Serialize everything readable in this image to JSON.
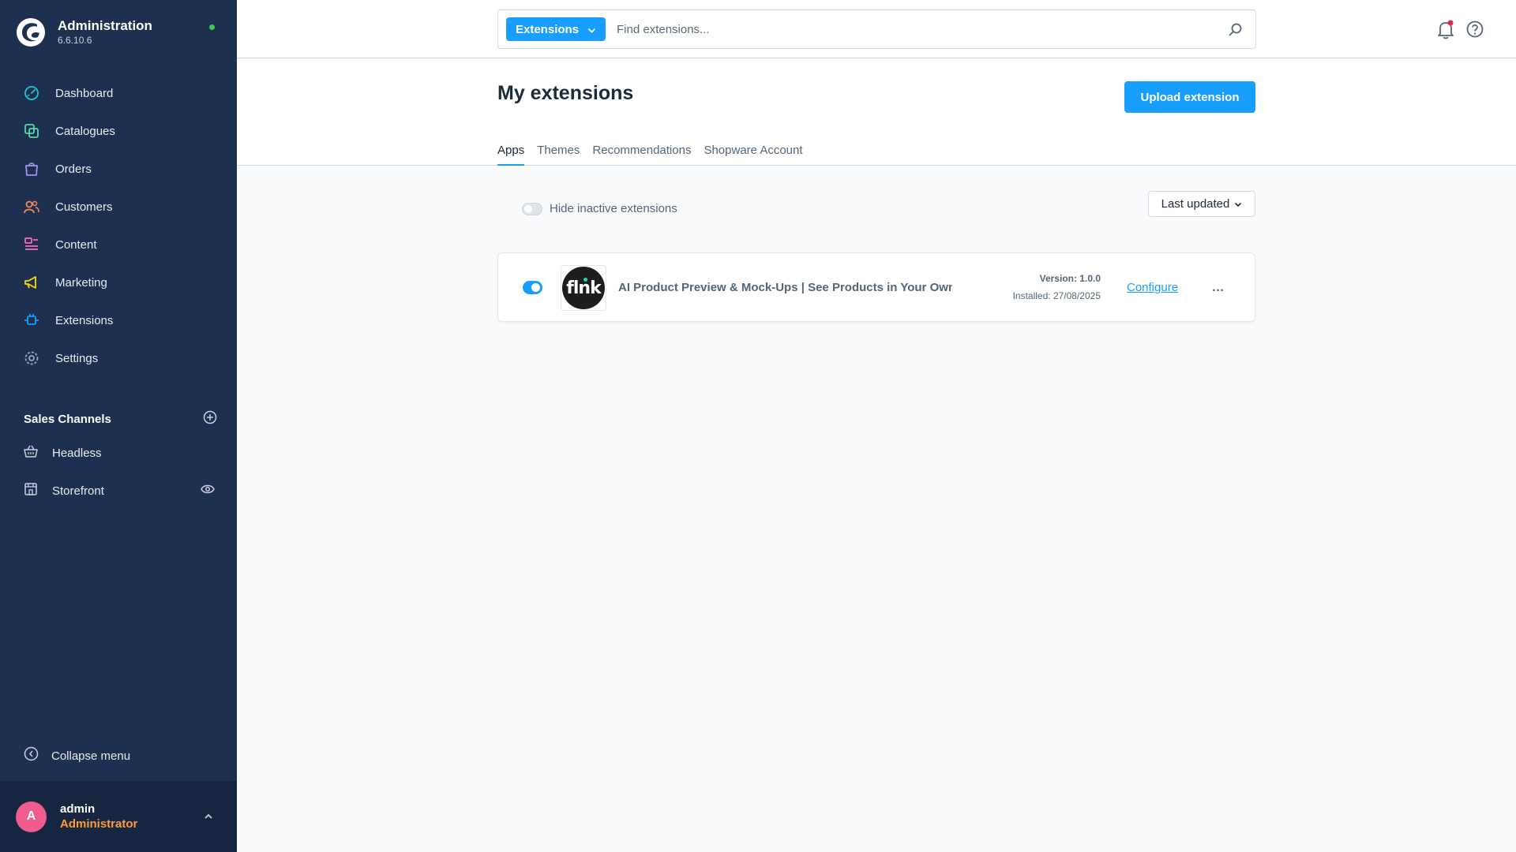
{
  "app": {
    "title": "Administration",
    "version": "6.6.10.6",
    "status_color": "#37d046"
  },
  "sidebar": {
    "items": [
      {
        "label": "Dashboard",
        "icon": "dashboard-icon",
        "color": "#28c2d9"
      },
      {
        "label": "Catalogues",
        "icon": "catalogues-icon",
        "color": "#57d9a3"
      },
      {
        "label": "Orders",
        "icon": "orders-icon",
        "color": "#a092f0"
      },
      {
        "label": "Customers",
        "icon": "customers-icon",
        "color": "#f88962"
      },
      {
        "label": "Content",
        "icon": "content-icon",
        "color": "#ff68b4"
      },
      {
        "label": "Marketing",
        "icon": "marketing-icon",
        "color": "#ffd700"
      },
      {
        "label": "Extensions",
        "icon": "extensions-icon",
        "color": "#189eff"
      },
      {
        "label": "Settings",
        "icon": "settings-icon",
        "color": "#9aa8b5"
      }
    ],
    "sales_channels": {
      "title": "Sales Channels",
      "items": [
        {
          "label": "Headless",
          "icon": "basket-icon"
        },
        {
          "label": "Storefront",
          "icon": "storefront-icon"
        }
      ]
    },
    "collapse_label": "Collapse menu",
    "user": {
      "initial": "A",
      "name": "admin",
      "role": "Administrator"
    }
  },
  "topbar": {
    "search_type": "Extensions",
    "search_placeholder": "Find extensions..."
  },
  "page": {
    "title": "My extensions",
    "upload_label": "Upload extension",
    "tabs": [
      {
        "label": "Apps",
        "active": true
      },
      {
        "label": "Themes",
        "active": false
      },
      {
        "label": "Recommendations",
        "active": false
      },
      {
        "label": "Shopware Account",
        "active": false
      }
    ],
    "hide_inactive_label": "Hide inactive extensions",
    "hide_inactive_on": false,
    "sort_label": "Last updated"
  },
  "extensions": [
    {
      "name": "AI Product Preview & Mock-Ups | See Products in Your Own Ho",
      "logo_text": "flnk",
      "active": true,
      "version": "Version: 1.0.0",
      "installed": "Installed: 27/08/2025",
      "configure_label": "Configure",
      "more_label": "…"
    }
  ],
  "colors": {
    "accent": "#189eff",
    "sidebar_bg": "#1e3050",
    "user_role": "#ff9b37",
    "avatar": "#f15c8e"
  }
}
